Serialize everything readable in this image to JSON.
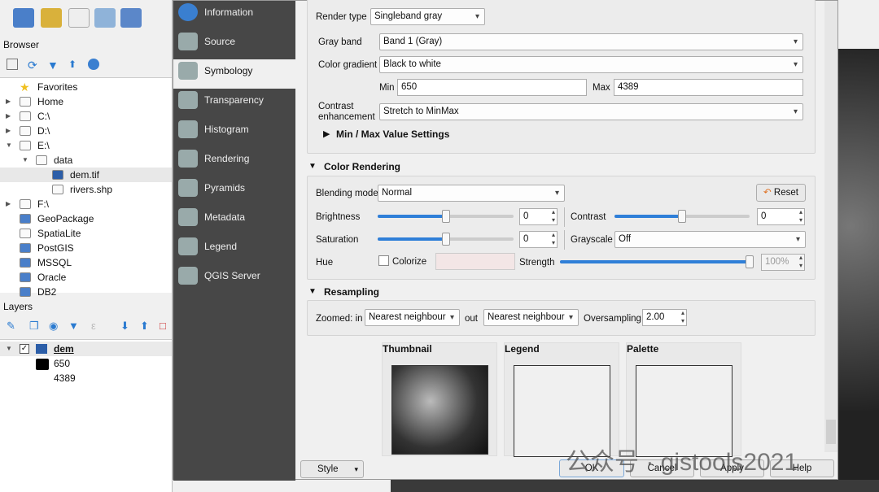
{
  "browser": {
    "title": "Browser",
    "items": [
      {
        "label": "Favorites",
        "icon": "star-icon"
      },
      {
        "label": "Home",
        "icon": "home-folder-icon"
      },
      {
        "label": "C:\\",
        "icon": "folder-icon"
      },
      {
        "label": "D:\\",
        "icon": "folder-icon"
      },
      {
        "label": "E:\\",
        "icon": "folder-icon"
      },
      {
        "label": "data",
        "icon": "folder-icon"
      },
      {
        "label": "dem.tif",
        "icon": "raster-icon"
      },
      {
        "label": "rivers.shp",
        "icon": "vector-icon"
      },
      {
        "label": "F:\\",
        "icon": "folder-icon"
      },
      {
        "label": "GeoPackage",
        "icon": "geopackage-icon"
      },
      {
        "label": "SpatiaLite",
        "icon": "spatialite-icon"
      },
      {
        "label": "PostGIS",
        "icon": "postgis-icon"
      },
      {
        "label": "MSSQL",
        "icon": "mssql-icon"
      },
      {
        "label": "Oracle",
        "icon": "oracle-icon"
      },
      {
        "label": "DB2",
        "icon": "db2-icon"
      }
    ]
  },
  "layers": {
    "title": "Layers",
    "layer": "dem",
    "min": "650",
    "max": "4389"
  },
  "sidebar": [
    "Information",
    "Source",
    "Symbology",
    "Transparency",
    "Histogram",
    "Rendering",
    "Pyramids",
    "Metadata",
    "Legend",
    "QGIS Server"
  ],
  "band": {
    "render_type_label": "Render type",
    "render_type": "Singleband gray",
    "gray_band_label": "Gray band",
    "gray_band": "Band 1 (Gray)",
    "gradient_label": "Color gradient",
    "gradient": "Black to white",
    "min_label": "Min",
    "min": "650",
    "max_label": "Max",
    "max": "4389",
    "contrast_label_1": "Contrast",
    "contrast_label_2": "enhancement",
    "contrast": "Stretch to MinMax",
    "minmax_settings": "Min / Max Value Settings"
  },
  "color": {
    "header": "Color Rendering",
    "blending_label": "Blending mode",
    "blending": "Normal",
    "reset": "Reset",
    "brightness_label": "Brightness",
    "brightness": "0",
    "brightness_level": 0,
    "contrast_label": "Contrast",
    "contrast": "0",
    "contrast_level": 0,
    "saturation_label": "Saturation",
    "saturation": "0",
    "saturation_level": 0,
    "grayscale_label": "Grayscale",
    "grayscale": "Off",
    "hue_label": "Hue",
    "colorize_label": "Colorize",
    "colorize_checked": false,
    "strength_label": "Strength",
    "strength": "100%",
    "strength_level": 100
  },
  "resampling": {
    "header": "Resampling",
    "zoomed_in_label": "Zoomed: in",
    "zoomed_in": "Nearest neighbour",
    "out_label": "out",
    "zoomed_out": "Nearest neighbour",
    "oversampling_label": "Oversampling",
    "oversampling": "2.00"
  },
  "preview": {
    "thumbnail": "Thumbnail",
    "legend": "Legend",
    "palette": "Palette"
  },
  "buttons": {
    "style": "Style",
    "ok": "OK",
    "cancel": "Cancel",
    "apply": "Apply",
    "help": "Help"
  },
  "watermark": "公众号 · gistools2021",
  "colors": {
    "accent": "#2f7fd8",
    "sidebar": "#474747"
  }
}
